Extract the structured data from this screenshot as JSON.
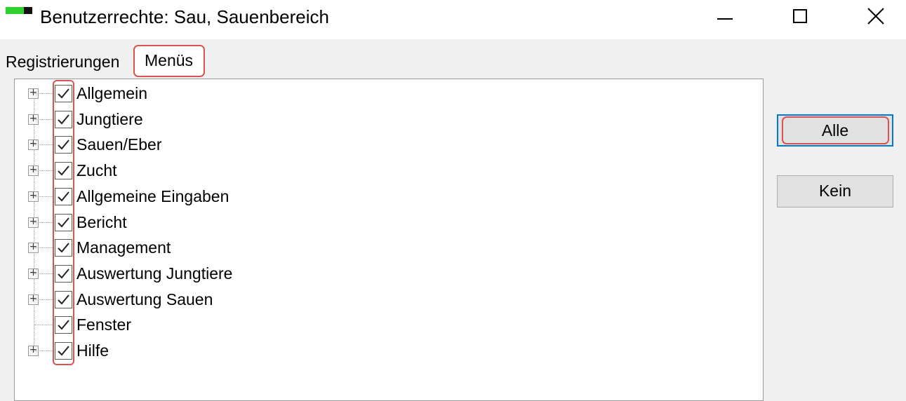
{
  "window": {
    "title": "Benutzerrechte: Sau, Sauenbereich",
    "app_icon": "app-status-icon",
    "controls": [
      "minimize-icon",
      "maximize-icon",
      "close-icon"
    ]
  },
  "tabs": [
    {
      "label": "Registrierungen",
      "selected": false
    },
    {
      "label": "Menüs",
      "selected": true
    }
  ],
  "tree": {
    "items": [
      {
        "label": "Allgemein",
        "checked": true,
        "expandable": true
      },
      {
        "label": "Jungtiere",
        "checked": true,
        "expandable": true
      },
      {
        "label": "Sauen/Eber",
        "checked": true,
        "expandable": true
      },
      {
        "label": "Zucht",
        "checked": true,
        "expandable": true
      },
      {
        "label": "Allgemeine Eingaben",
        "checked": true,
        "expandable": true
      },
      {
        "label": "Bericht",
        "checked": true,
        "expandable": true
      },
      {
        "label": "Management",
        "checked": true,
        "expandable": true
      },
      {
        "label": "Auswertung Jungtiere",
        "checked": true,
        "expandable": true
      },
      {
        "label": "Auswertung Sauen",
        "checked": true,
        "expandable": true
      },
      {
        "label": "Fenster",
        "checked": true,
        "expandable": false
      },
      {
        "label": "Hilfe",
        "checked": true,
        "expandable": true
      }
    ]
  },
  "buttons": {
    "all_label": "Alle",
    "none_label": "Kein"
  },
  "colors": {
    "highlight": "#d9534f",
    "focus": "#0078d7",
    "icon_green": "#2fd12f"
  }
}
